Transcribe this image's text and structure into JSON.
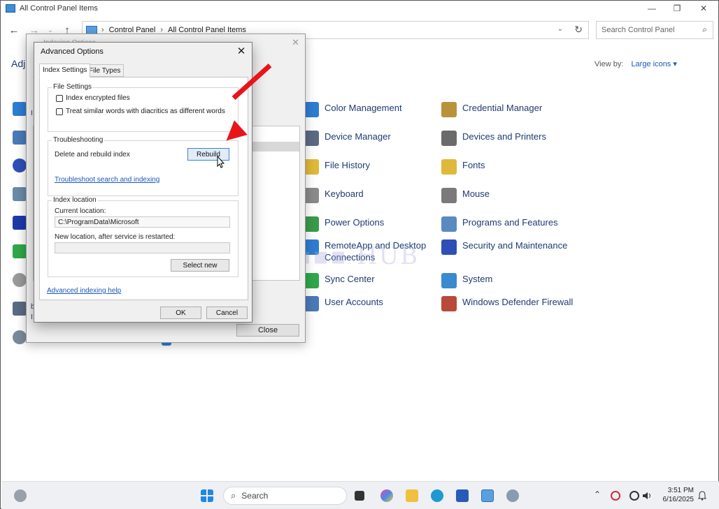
{
  "window": {
    "title": "All Control Panel Items",
    "controls": {
      "minimize": "—",
      "maximize": "❐",
      "close": "✕"
    }
  },
  "nav": {
    "back": "←",
    "forward": "→",
    "recent": "⌄",
    "up": "↑",
    "breadcrumb": [
      "Control Panel",
      "All Control Panel Items"
    ],
    "separator": "›",
    "dropdown": "⌄",
    "refresh": "↻",
    "search_placeholder": "Search Control Panel",
    "search_icon": "⌕"
  },
  "page": {
    "title_fragment": "Adj",
    "view_by_label": "View by:",
    "view_by_value": "Large icons ▾"
  },
  "control_panel_items": [
    {
      "label": "Color Management",
      "color": "#2e7dd1"
    },
    {
      "label": "Credential Manager",
      "color": "#b8933a"
    },
    {
      "label": "Device Manager",
      "color": "#5a6b82"
    },
    {
      "label": "Devices and Printers",
      "color": "#6b6b6b"
    },
    {
      "label": "File History",
      "color": "#e0b83a"
    },
    {
      "label": "Fonts",
      "color": "#e0b83a"
    },
    {
      "label": "Keyboard",
      "color": "#8a8a8a"
    },
    {
      "label": "Mouse",
      "color": "#7a7a7a"
    },
    {
      "label": "Power Options",
      "color": "#3a9a4a"
    },
    {
      "label": "Programs and Features",
      "color": "#5a8ac0"
    },
    {
      "label": "RemoteApp and Desktop Connections",
      "color": "#2e7dd1"
    },
    {
      "label": "Security and Maintenance",
      "color": "#2e4fb8"
    },
    {
      "label": "Sync Center",
      "color": "#2ea84a"
    },
    {
      "label": "System",
      "color": "#3a8ad0"
    },
    {
      "label": "User Accounts",
      "color": "#4a7ab8"
    },
    {
      "label": "Windows Defender Firewall",
      "color": "#b84a3a"
    }
  ],
  "indexing_dialog": {
    "title": "Indexing Options",
    "close_icon": "✕",
    "close_button": "Close",
    "left_fragments": [
      "I",
      "b",
      "I"
    ]
  },
  "advanced_dialog": {
    "title": "Advanced Options",
    "close_icon": "✕",
    "tabs": [
      "Index Settings",
      "File Types"
    ],
    "file_settings": {
      "label": "File Settings",
      "index_encrypted": "Index encrypted files",
      "diacritics": "Treat similar words with diacritics as different words"
    },
    "troubleshooting": {
      "label": "Troubleshooting",
      "delete_rebuild": "Delete and rebuild index",
      "rebuild_button": "Rebuild",
      "troubleshoot_link": "Troubleshoot search and indexing"
    },
    "index_location": {
      "label": "Index location",
      "current_label": "Current location:",
      "current_value": "C:\\ProgramData\\Microsoft",
      "new_label": "New location, after service is restarted:",
      "select_new": "Select new"
    },
    "help_link": "Advanced indexing help",
    "ok": "OK",
    "cancel": "Cancel"
  },
  "taskbar": {
    "search_label": "Search",
    "search_icon": "⌕",
    "tray_chevron": "⌃",
    "time": "3:51 PM",
    "date": "6/16/2025"
  }
}
